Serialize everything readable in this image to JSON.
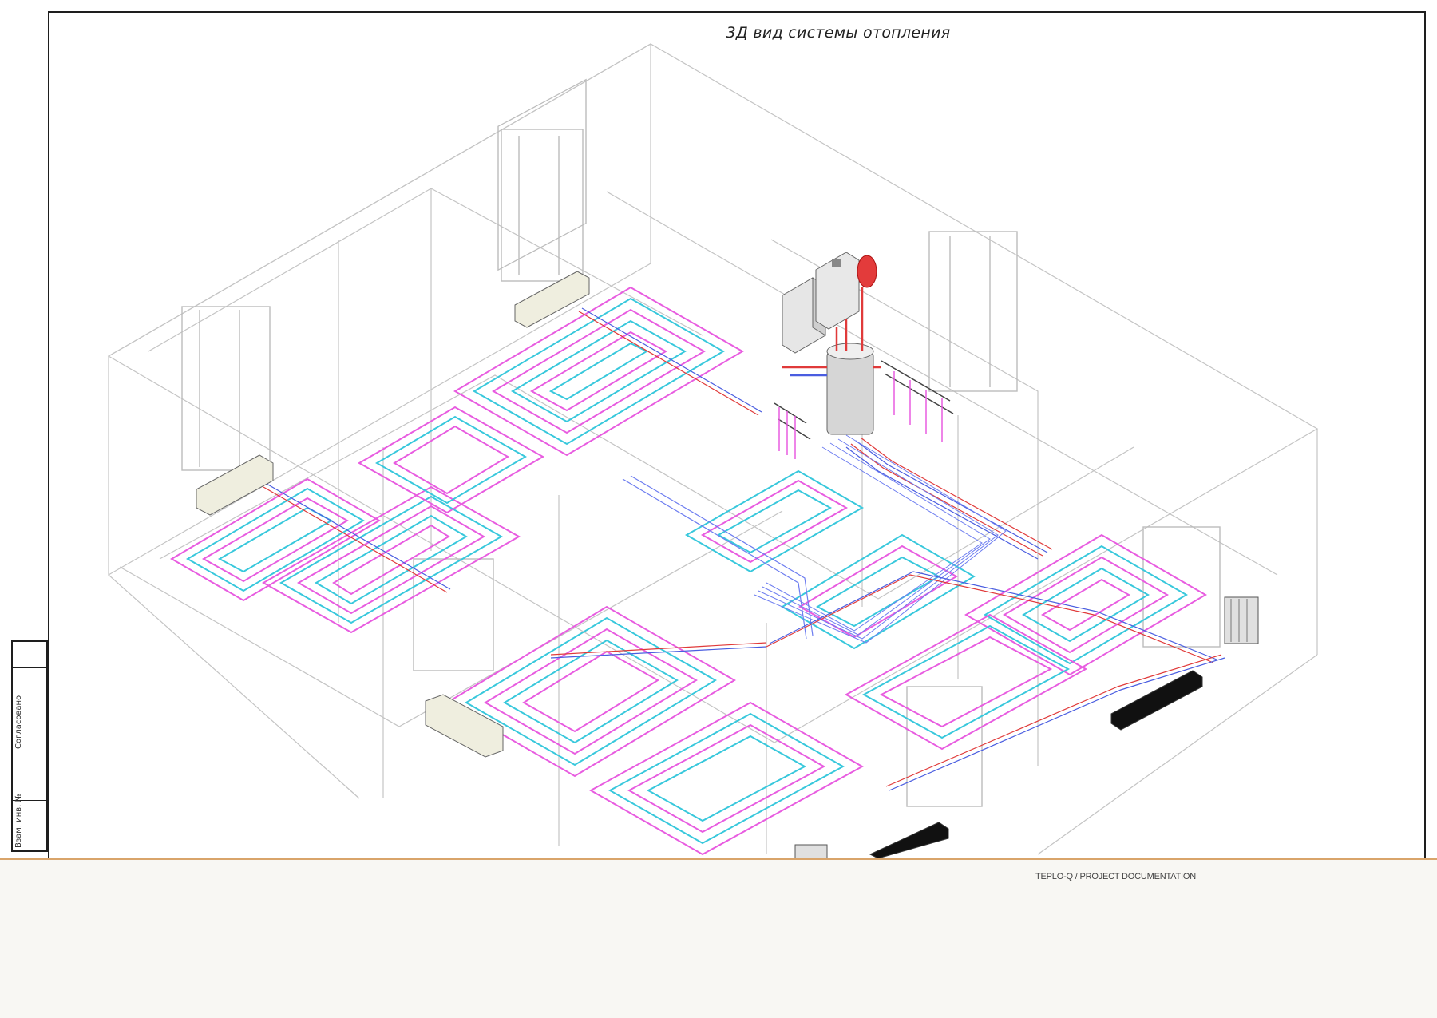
{
  "drawing": {
    "title": "3Д вид системы отопления"
  },
  "stamp": {
    "agreed_label": "Согласовано",
    "inv_label": "Взам. инв. №"
  },
  "footer": {
    "text": "TEPLO-Q / PROJECT DOCUMENTATION"
  },
  "colors": {
    "supply_pipe": "#e85ce0",
    "return_pipe": "#38c8dc",
    "supply_line": "#e03a3a",
    "return_line": "#4a5de0",
    "walls": "#b8b8b8",
    "footer_accent": "#d9a46a"
  },
  "icons": [
    "boiler-icon",
    "expansion-tank-icon",
    "water-heater-icon",
    "manifold-icon",
    "radiator-icon",
    "convector-icon",
    "window-icon"
  ]
}
